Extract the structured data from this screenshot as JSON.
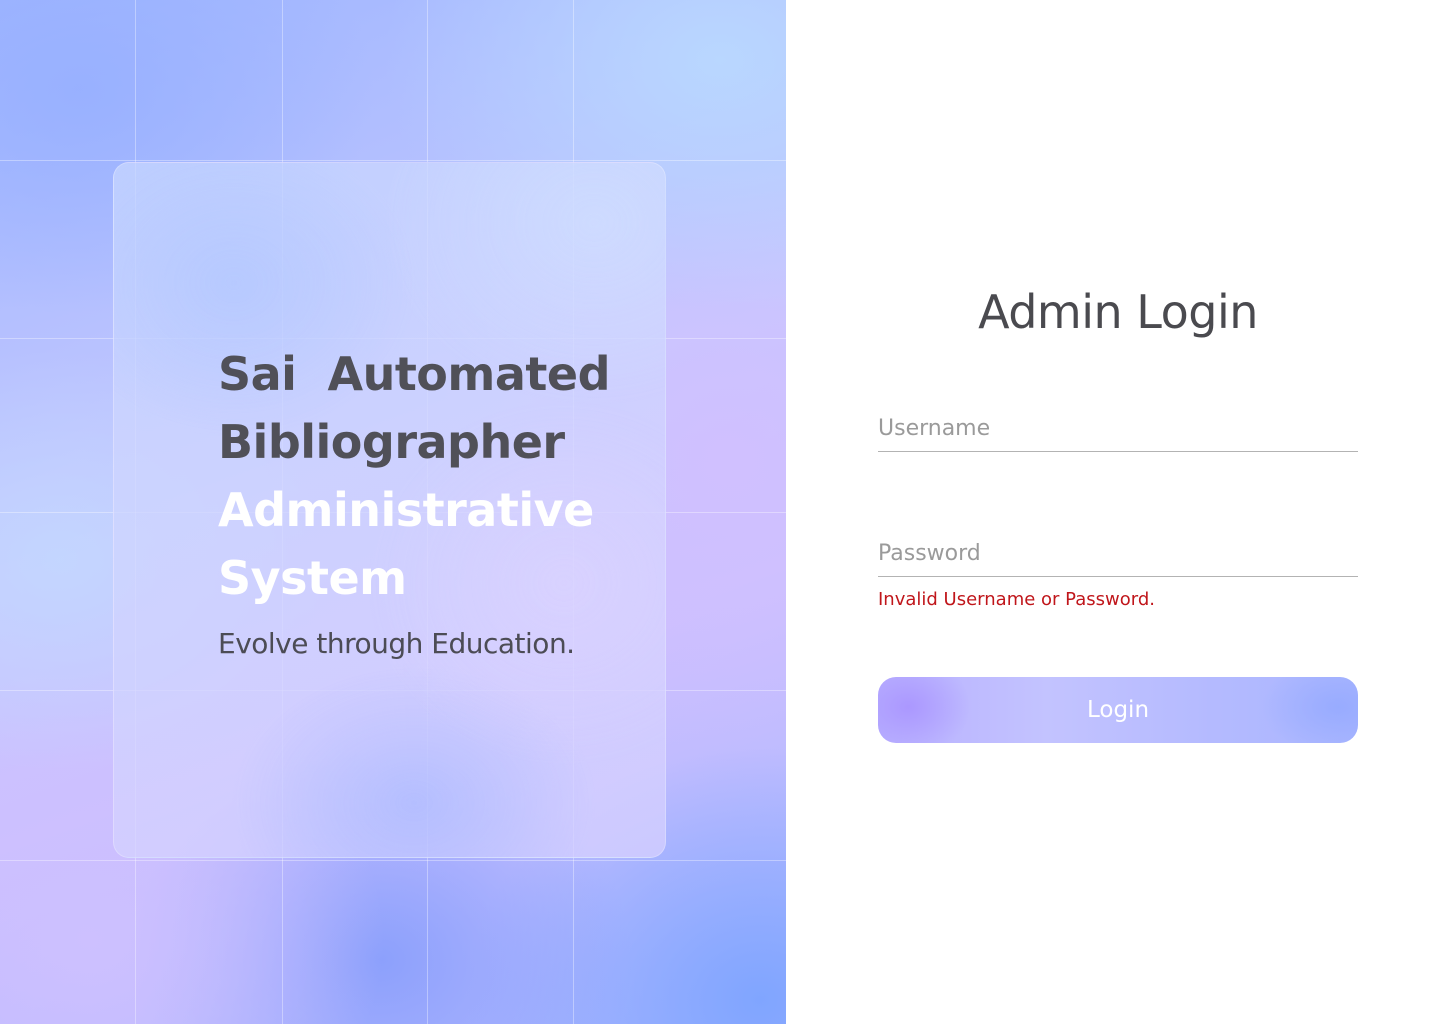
{
  "hero": {
    "title_dark_line1": "Sai  Automated",
    "title_dark_line2": "Bibliographer",
    "title_light_line1": "Administrative",
    "title_light_line2": "System",
    "tagline": "Evolve through Education."
  },
  "login": {
    "title": "Admin Login",
    "username": {
      "placeholder": "Username",
      "value": ""
    },
    "password": {
      "placeholder": "Password",
      "value": ""
    },
    "error": "Invalid Username or Password.",
    "button_label": "Login"
  },
  "colors": {
    "error": "#c0161b",
    "title_text": "#4a4a4f",
    "button_gradient_start": "#b8b0ff",
    "button_gradient_end": "#a9b6ff",
    "hero_text_dark": "#505058",
    "hero_text_light": "#ffffff"
  }
}
